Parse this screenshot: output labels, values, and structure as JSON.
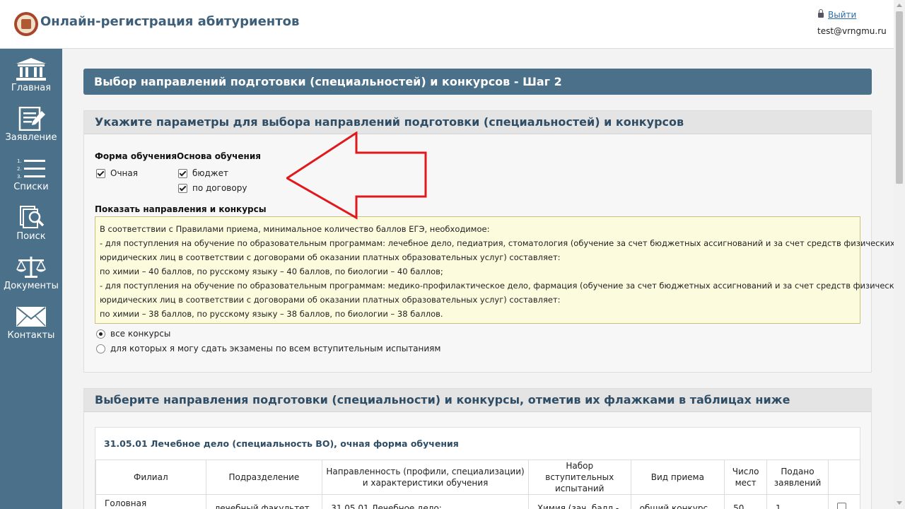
{
  "header": {
    "title": "Онлайн-регистрация абитуриентов",
    "logout_label": "Выйти",
    "user_email": "test@vrngmu.ru"
  },
  "sidebar": {
    "items": [
      {
        "label": "Главная",
        "icon": "building-icon"
      },
      {
        "label": "Заявление",
        "icon": "document-edit-icon"
      },
      {
        "label": "Списки",
        "icon": "numbered-list-icon"
      },
      {
        "label": "Поиск",
        "icon": "search-documents-icon"
      },
      {
        "label": "Документы",
        "icon": "scales-icon"
      },
      {
        "label": "Контакты",
        "icon": "envelope-icon"
      }
    ]
  },
  "step_title": "Выбор направлений подготовки (специальностей) и конкурсов - Шаг 2",
  "params": {
    "title": "Укажите параметры для выбора направлений подготовки (специальностей) и конкурсов",
    "form_label": "Форма обучения",
    "form_options": [
      {
        "label": "Очная",
        "checked": true
      }
    ],
    "basis_label": "Основа обучения",
    "basis_options": [
      {
        "label": "бюджет",
        "checked": true
      },
      {
        "label": "по договору",
        "checked": true
      }
    ],
    "show_label": "Показать направления и конкурсы",
    "notice_lines": [
      "В соответствии с Правилами приема, минимальное количество баллов ЕГЭ, необходимое:",
      "- для поступления на обучение по образовательным программам: лечебное дело, педиатрия, стоматология (обучение за счет бюджетных ассигнований и за счет средств физических лиц и",
      "юридических лиц в соответствии с договорами об оказании платных образовательных услуг) составляет:",
      "по химии – 40 баллов, по русскому языку – 40 баллов, по биологии – 40 баллов;",
      "- для поступления на обучение по образовательным программам: медико-профилактическое дело, фармация (обучение за счет бюджетных ассигнований и за счет средств физических лиц и",
      "юридических лиц в соответствии с договорами об оказании платных образовательных услуг) составляет:",
      "по химии – 38 баллов, по русскому языку – 38 баллов, по биологии – 38 баллов."
    ],
    "radio_options": [
      {
        "label": "все конкурсы",
        "checked": true
      },
      {
        "label": "для которых я могу сдать экзамены по всем вступительным испытаниям",
        "checked": false
      }
    ]
  },
  "selection": {
    "title": "Выберите направления подготовки (специальности) и конкурсы, отметив их флажками в таблицах ниже",
    "program_title": "31.05.01 Лечебное дело (специальность ВО), очная форма обучения",
    "columns": [
      "Филиал",
      "Подразделение",
      "Направленность (профили, специализации) и характеристики обучения",
      "Набор вступительных испытаний",
      "Вид приема",
      "Число мест",
      "Подано заявлений",
      ""
    ],
    "rows": [
      [
        "Головная организация",
        "лечебный факультет",
        "31.05.01 Лечебное дело:",
        "Химия (зач. балл -",
        "общий конкурс",
        "50",
        "1"
      ]
    ]
  },
  "colors": {
    "sidebar": "#4b7089",
    "accent_text": "#2f4e66",
    "notice_bg": "#fdfbde",
    "arrow": "#e0191c"
  }
}
